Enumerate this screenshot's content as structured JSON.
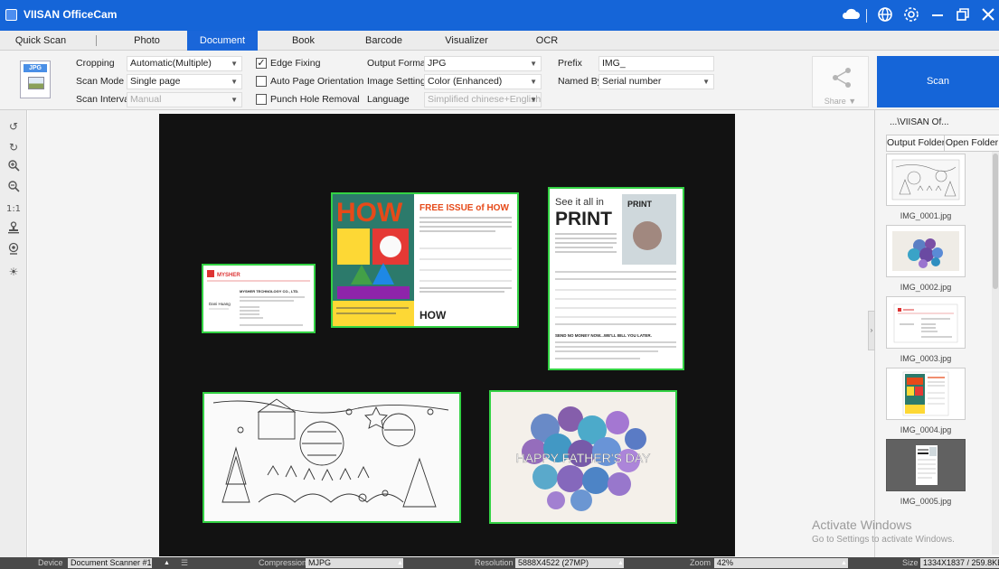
{
  "app": {
    "title": "VIISAN OfficeCam"
  },
  "tabs": [
    {
      "label": "Quick Scan"
    },
    {
      "label": "Photo"
    },
    {
      "label": "Document"
    },
    {
      "label": "Book"
    },
    {
      "label": "Barcode"
    },
    {
      "label": "Visualizer"
    },
    {
      "label": "OCR"
    }
  ],
  "active_tab": "Document",
  "toolbar": {
    "format_badge": "JPG",
    "cropping": {
      "label": "Cropping",
      "value": "Automatic(Multiple)"
    },
    "scan_mode": {
      "label": "Scan Mode",
      "value": "Single page"
    },
    "scan_interval": {
      "label": "Scan Interval",
      "value": "Manual"
    },
    "edge_fixing": {
      "label": "Edge Fixing",
      "checked": true
    },
    "auto_orientation": {
      "label": "Auto Page Orientation",
      "checked": false
    },
    "punch_hole": {
      "label": "Punch Hole Removal",
      "checked": false
    },
    "output_format": {
      "label": "Output Format",
      "value": "JPG"
    },
    "image_settings": {
      "label": "Image Settings",
      "value": "Color (Enhanced)"
    },
    "language": {
      "label": "Language",
      "value": "Simplified chinese+English"
    },
    "prefix": {
      "label": "Prefix",
      "value": "IMG_"
    },
    "named_by": {
      "label": "Named By",
      "value": "Serial number"
    },
    "share_label": "Share",
    "scan_label": "Scan"
  },
  "left_tools": [
    "rotate-left",
    "rotate-right",
    "zoom-in",
    "zoom-out",
    "actual-size",
    "stamp",
    "webcam",
    "brightness"
  ],
  "left_tools_text": {
    "actual_size": "1:1"
  },
  "documents": {
    "business_card": {
      "brand": "MYSHER",
      "company": "MYSHER TECHNOLOGY CO., LTD.",
      "person": "Dani Huang"
    },
    "magazine": {
      "cover_word": "HOW",
      "headline": "FREE ISSUE of HOW",
      "footer_word": "HOW"
    },
    "print_ad": {
      "line1": "See it all in",
      "line2": "PRINT",
      "cover": "PRINT",
      "send_line": "SEND NO MONEY NOW...WE'LL BILL YOU LATER."
    },
    "greeting_card": {
      "text": "HAPPY FATHER'S DAY"
    }
  },
  "right_panel": {
    "path": "...\\VIISAN Of...",
    "output_folder": "Output Folder",
    "open_folder": "Open Folder",
    "files": [
      {
        "name": "IMG_0001.jpg"
      },
      {
        "name": "IMG_0002.jpg"
      },
      {
        "name": "IMG_0003.jpg"
      },
      {
        "name": "IMG_0004.jpg"
      },
      {
        "name": "IMG_0005.jpg"
      }
    ]
  },
  "watermark": {
    "line1": "Activate Windows",
    "line2": "Go to Settings to activate Windows."
  },
  "status": {
    "device_label": "Device",
    "device_value": "Document Scanner #1",
    "compression_label": "Compression",
    "compression_value": "MJPG",
    "resolution_label": "Resolution",
    "resolution_value": "5888X4522 (27MP)",
    "zoom_label": "Zoom",
    "zoom_value": "42%",
    "size_label": "Size",
    "size_value": "1334X1837 / 259.8KB"
  },
  "colors": {
    "titlebar": "#1565d8",
    "active_tab": "#1a66d9",
    "scan_button": "#1565d8",
    "crop_border": "#33d244",
    "preview_bg": "#121212",
    "statusbar": "#4a4a4a"
  }
}
